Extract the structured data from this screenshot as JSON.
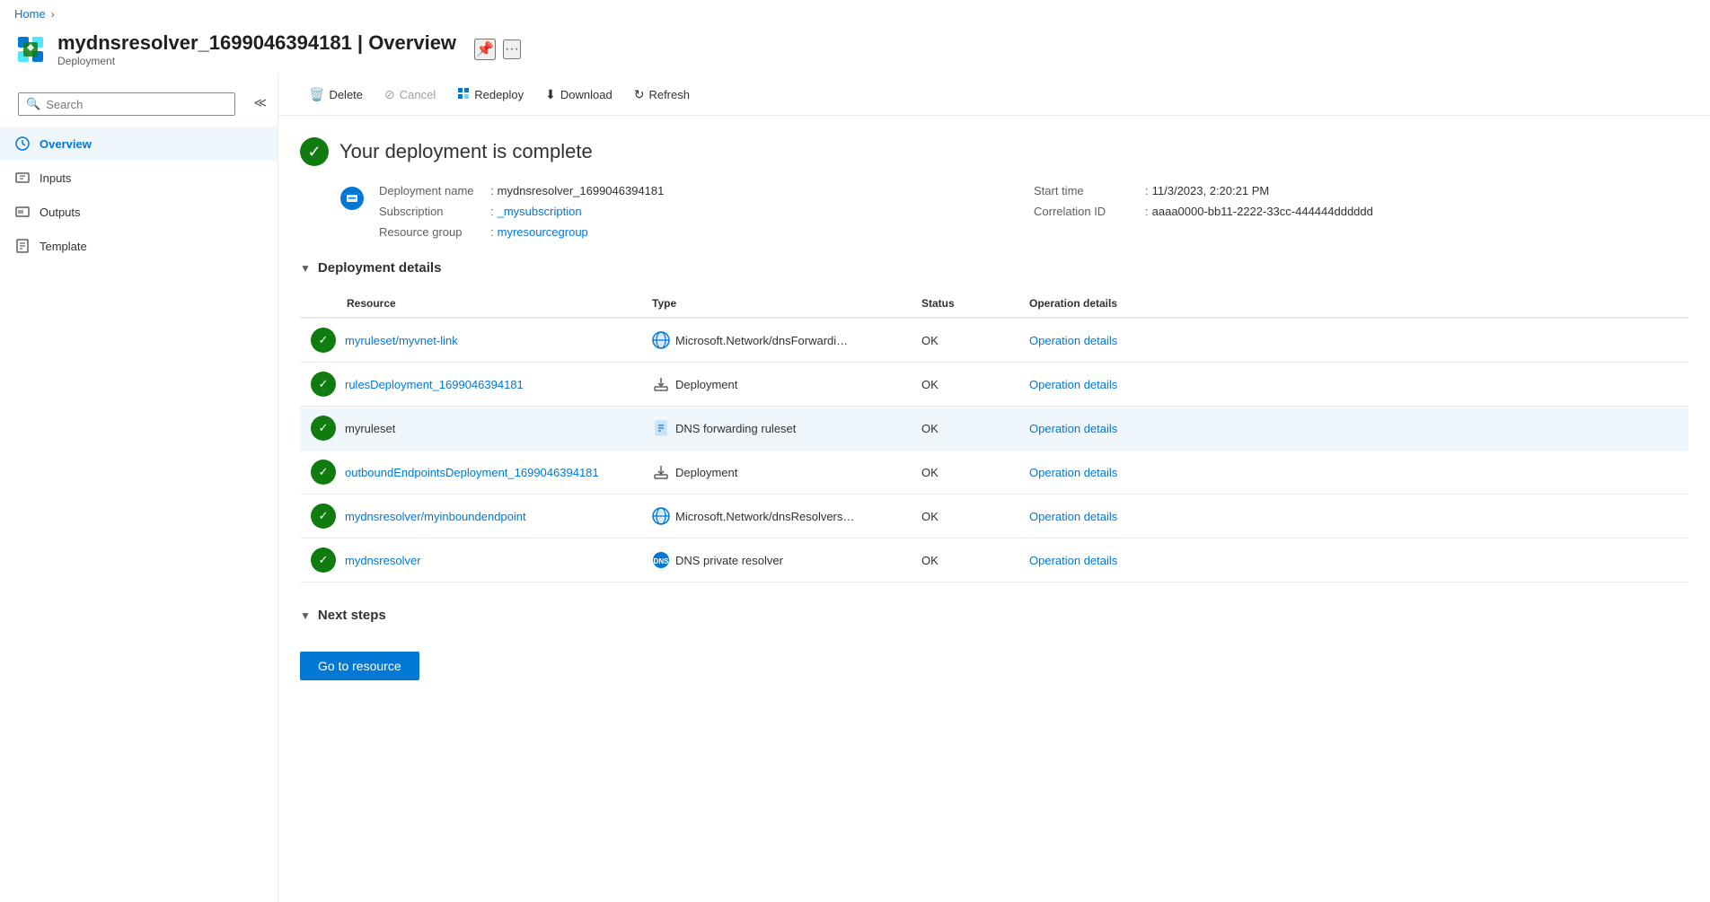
{
  "breadcrumb": {
    "home_label": "Home",
    "separator": "›"
  },
  "header": {
    "title": "mydnsresolver_1699046394181 | Overview",
    "subtitle": "Deployment",
    "pin_icon": "📌",
    "more_icon": "···"
  },
  "toolbar": {
    "delete_label": "Delete",
    "cancel_label": "Cancel",
    "redeploy_label": "Redeploy",
    "download_label": "Download",
    "refresh_label": "Refresh"
  },
  "sidebar": {
    "search_placeholder": "Search",
    "items": [
      {
        "id": "overview",
        "label": "Overview",
        "active": true
      },
      {
        "id": "inputs",
        "label": "Inputs",
        "active": false
      },
      {
        "id": "outputs",
        "label": "Outputs",
        "active": false
      },
      {
        "id": "template",
        "label": "Template",
        "active": false
      }
    ]
  },
  "content": {
    "status_title": "Your deployment is complete",
    "meta": {
      "deployment_name_label": "Deployment name",
      "deployment_name_value": "mydnsresolver_1699046394181",
      "subscription_label": "Subscription",
      "subscription_value": "_mysubscription",
      "resource_group_label": "Resource group",
      "resource_group_value": "myresourcegroup",
      "start_time_label": "Start time",
      "start_time_value": "11/3/2023, 2:20:21 PM",
      "correlation_id_label": "Correlation ID",
      "correlation_id_value": "aaaa0000-bb11-2222-33cc-444444dddddd"
    },
    "deployment_details": {
      "section_title": "Deployment details",
      "table_headers": [
        "Resource",
        "Type",
        "Status",
        "Operation details"
      ],
      "rows": [
        {
          "resource": "myruleset/myvnet-link",
          "resource_link": true,
          "type_icon": "network",
          "type": "Microsoft.Network/dnsForwardi…",
          "status": "OK",
          "op_details": "Operation details",
          "highlighted": false
        },
        {
          "resource": "rulesDeployment_1699046394181",
          "resource_link": true,
          "type_icon": "deployment",
          "type": "Deployment",
          "status": "OK",
          "op_details": "Operation details",
          "highlighted": false
        },
        {
          "resource": "myruleset",
          "resource_link": false,
          "type_icon": "document",
          "type": "DNS forwarding ruleset",
          "status": "OK",
          "op_details": "Operation details",
          "highlighted": true
        },
        {
          "resource": "outboundEndpointsDeployment_1699046394181",
          "resource_link": true,
          "type_icon": "deployment",
          "type": "Deployment",
          "status": "OK",
          "op_details": "Operation details",
          "highlighted": false
        },
        {
          "resource": "mydnsresolver/myinboundendpoint",
          "resource_link": true,
          "type_icon": "network",
          "type": "Microsoft.Network/dnsResolvers…",
          "status": "OK",
          "op_details": "Operation details",
          "highlighted": false
        },
        {
          "resource": "mydnsresolver",
          "resource_link": true,
          "type_icon": "dns",
          "type": "DNS private resolver",
          "status": "OK",
          "op_details": "Operation details",
          "highlighted": false
        }
      ]
    },
    "next_steps": {
      "section_title": "Next steps",
      "go_to_resource_label": "Go to resource"
    }
  }
}
